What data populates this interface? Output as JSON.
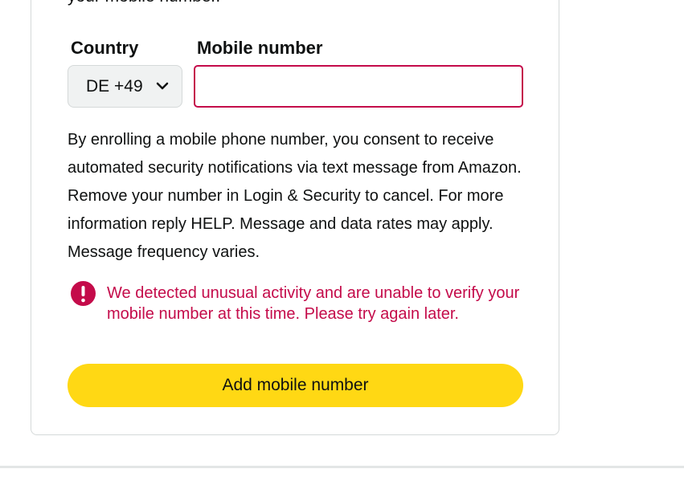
{
  "form": {
    "cut_text": "your mobile number.",
    "country_label": "Country",
    "mobile_label": "Mobile number",
    "country_value": "DE +49",
    "mobile_value": "",
    "mobile_placeholder": "",
    "consent_text": "By enrolling a mobile phone number, you consent to receive automated security notifications via text message from Amazon. Remove your number in Login & Security to cancel. For more information reply HELP. Message and data rates may apply. Message frequency varies.",
    "error_message": "We detected unusual activity and are unable to verify your mobile number at this time. Please try again later.",
    "add_button_label": "Add mobile number"
  },
  "icons": {
    "chevron": "chevron-down-icon",
    "error": "exclamation-circle-icon"
  },
  "colors": {
    "error": "#c40b4a",
    "button": "#ffd814",
    "select_bg": "#f0f2f2",
    "border": "#d5d9d9"
  }
}
